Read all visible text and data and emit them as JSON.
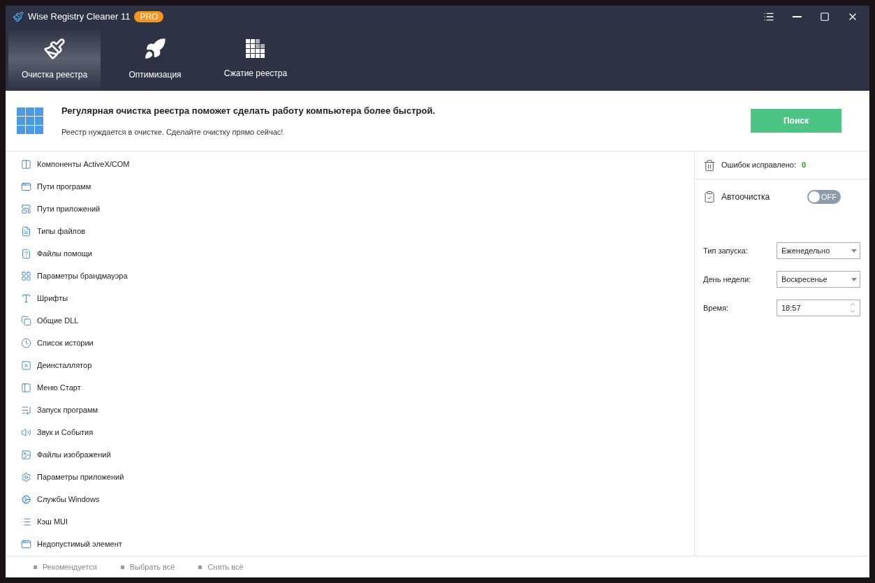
{
  "window": {
    "title": "Wise Registry Cleaner 11",
    "badge": "PRO"
  },
  "tabs": [
    {
      "label": "Очистка реестра",
      "selected": true
    },
    {
      "label": "Оптимизация",
      "selected": false
    },
    {
      "label": "Сжатие реестра",
      "selected": false
    }
  ],
  "banner": {
    "headline": "Регулярная очистка реестра поможет сделать работу компьютера более быстрой.",
    "message": "Реестр нуждается в очистке. Сделайте очистку прямо сейчас!",
    "button": "Поиск"
  },
  "categories": [
    {
      "label": "Компоненты ActiveX/COM"
    },
    {
      "label": "Пути программ"
    },
    {
      "label": "Пути приложений"
    },
    {
      "label": "Типы файлов"
    },
    {
      "label": "Файлы помощи"
    },
    {
      "label": "Параметры брандмауэра"
    },
    {
      "label": "Шрифты"
    },
    {
      "label": "Общие DLL"
    },
    {
      "label": "Список истории"
    },
    {
      "label": "Деинсталлятор"
    },
    {
      "label": "Меню Старт"
    },
    {
      "label": "Запуск программ"
    },
    {
      "label": "Звук и События"
    },
    {
      "label": "Файлы изображений"
    },
    {
      "label": "Параметры приложений"
    },
    {
      "label": "Службы Windows"
    },
    {
      "label": "Кэш MUI"
    },
    {
      "label": "Недопустимый элемент"
    }
  ],
  "errors_fixed": {
    "label": "Ошибок исправлено:",
    "count": "0"
  },
  "autoclean": {
    "label": "Автоочистка",
    "on": false,
    "toggle_text": "OFF"
  },
  "schedule": [
    {
      "kind": "select",
      "label": "Тип запуска:",
      "value": "Еженедельно"
    },
    {
      "kind": "select",
      "label": "День недели:",
      "value": "Воскресенье"
    },
    {
      "kind": "spin",
      "label": "Время:",
      "value": "18:57"
    }
  ],
  "footer_links": [
    "Рекомендуется",
    "Выбрать всё",
    "Снять всё"
  ]
}
